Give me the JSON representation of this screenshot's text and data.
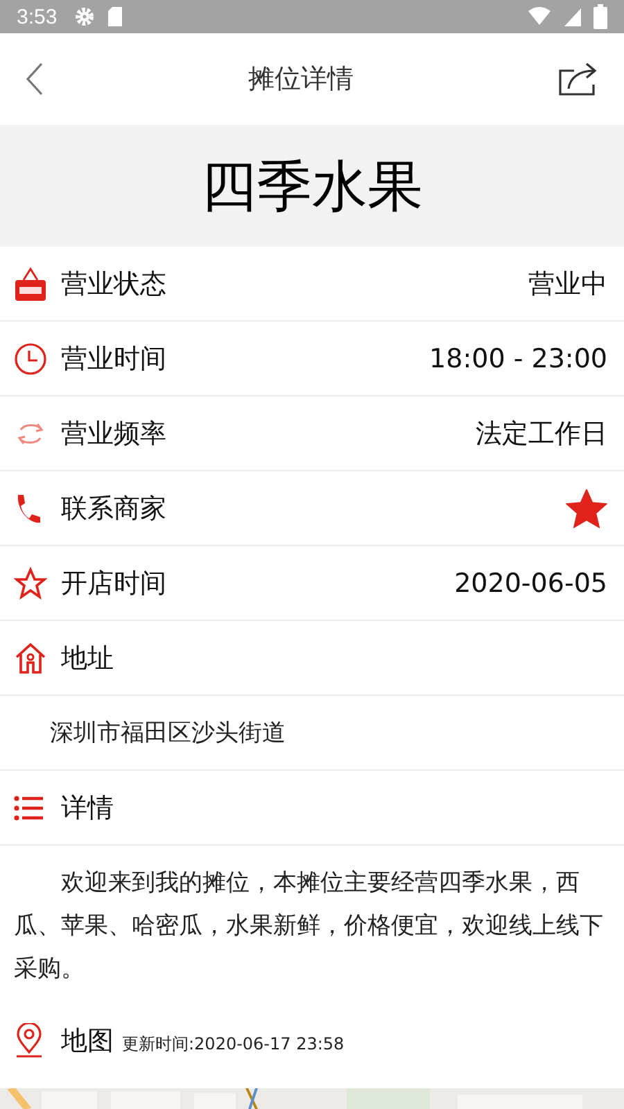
{
  "status_bar": {
    "time": "3:53"
  },
  "header": {
    "title": "摊位详情"
  },
  "stall": {
    "name": "四季水果"
  },
  "info_rows": [
    {
      "kind": "value",
      "label": "营业状态",
      "value": "营业中"
    },
    {
      "kind": "value",
      "label": "营业时间",
      "value": "18:00 - 23:00"
    },
    {
      "kind": "value",
      "label": "营业频率",
      "value": "法定工作日"
    },
    {
      "kind": "star",
      "label": "联系商家",
      "starred": true
    },
    {
      "kind": "value",
      "label": "开店时间",
      "value": "2020-06-05"
    }
  ],
  "address": {
    "label": "地址",
    "text": "深圳市福田区沙头街道"
  },
  "details": {
    "label": "详情",
    "text": "欢迎来到我的摊位，本摊位主要经营四季水果，西瓜、苹果、哈密瓜，水果新鲜，价格便宜，欢迎线上线下采购。"
  },
  "map": {
    "label": "地图",
    "updated": "更新时间:2020-06-17 23:58",
    "kind": "picture"
  }
}
